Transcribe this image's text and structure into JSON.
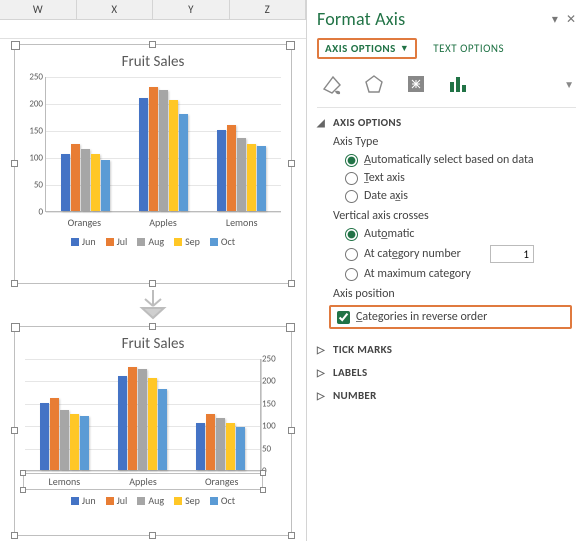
{
  "columns": [
    "W",
    "X",
    "Y",
    "Z"
  ],
  "colors": {
    "Jun": "#4473c5",
    "Jul": "#e87d34",
    "Aug": "#a6a6a6",
    "Sep": "#ffc726",
    "Oct": "#5b9bd5"
  },
  "chart_data": [
    {
      "type": "bar",
      "title": "Fruit Sales",
      "ylim": [
        0,
        250
      ],
      "yticks": [
        0,
        50,
        100,
        150,
        200,
        250
      ],
      "categories": [
        "Oranges",
        "Apples",
        "Lemons"
      ],
      "series": [
        {
          "name": "Jun",
          "values": [
            105,
            210,
            150
          ]
        },
        {
          "name": "Jul",
          "values": [
            125,
            230,
            160
          ]
        },
        {
          "name": "Aug",
          "values": [
            115,
            225,
            135
          ]
        },
        {
          "name": "Sep",
          "values": [
            105,
            205,
            125
          ]
        },
        {
          "name": "Oct",
          "values": [
            95,
            180,
            120
          ]
        }
      ],
      "axis": "left"
    },
    {
      "type": "bar",
      "title": "Fruit Sales",
      "ylim": [
        0,
        250
      ],
      "yticks": [
        0,
        50,
        100,
        150,
        200,
        250
      ],
      "categories": [
        "Lemons",
        "Apples",
        "Oranges"
      ],
      "series": [
        {
          "name": "Jun",
          "values": [
            150,
            210,
            105
          ]
        },
        {
          "name": "Jul",
          "values": [
            160,
            230,
            125
          ]
        },
        {
          "name": "Aug",
          "values": [
            135,
            225,
            115
          ]
        },
        {
          "name": "Sep",
          "values": [
            125,
            205,
            105
          ]
        },
        {
          "name": "Oct",
          "values": [
            120,
            180,
            95
          ]
        }
      ],
      "axis": "right",
      "axis_selected": true
    }
  ],
  "pane": {
    "title": "Format Axis",
    "tabs": {
      "axis_options": "AXIS OPTIONS",
      "text_options": "TEXT OPTIONS"
    },
    "section": "AXIS OPTIONS",
    "axis_type_label": "Axis Type",
    "axis_type": {
      "auto": "Automatically select based on data",
      "text": "Text axis",
      "date": "Date axis"
    },
    "vac_label": "Vertical axis crosses",
    "vac": {
      "auto": "Automatic",
      "atcat": "At category number",
      "atmax": "At maximum category",
      "num": "1"
    },
    "axis_pos_label": "Axis position",
    "reverse": "Categories in reverse order",
    "tick": "TICK MARKS",
    "labels": "LABELS",
    "number": "NUMBER"
  }
}
